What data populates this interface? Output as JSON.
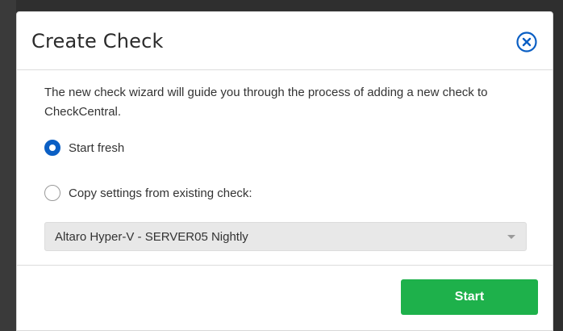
{
  "dialog": {
    "title": "Create Check",
    "close_icon": "close-circle-icon",
    "intro_text": "The new check wizard will guide you through the process of adding a new check to CheckCentral.",
    "options": [
      {
        "label": "Start fresh",
        "selected": true
      },
      {
        "label": "Copy settings from existing check:",
        "selected": false
      }
    ],
    "existing_check_select": {
      "value": "Altaro Hyper-V - SERVER05 Nightly"
    },
    "start_button_label": "Start"
  },
  "colors": {
    "accent_blue": "#0b5fc4",
    "start_green": "#1eb14b",
    "backdrop": "#2f2f2f"
  }
}
